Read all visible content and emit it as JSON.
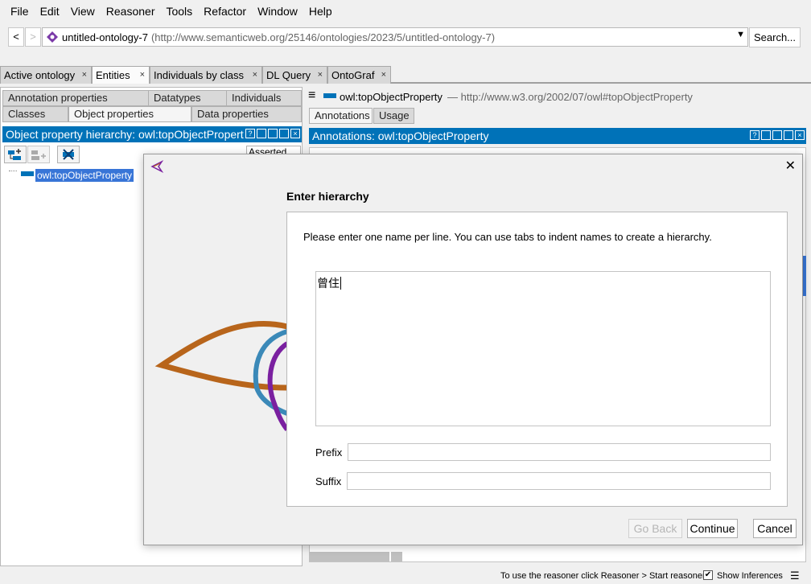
{
  "menu": [
    "File",
    "Edit",
    "View",
    "Reasoner",
    "Tools",
    "Refactor",
    "Window",
    "Help"
  ],
  "address": {
    "back": "<",
    "forward": ">",
    "ontology_name": "untitled-ontology-7",
    "ontology_iri": "(http://www.semanticweb.org/25146/ontologies/2023/5/untitled-ontology-7)",
    "search_label": "Search..."
  },
  "tabs": [
    {
      "label": "Active ontology"
    },
    {
      "label": "Entities",
      "active": true
    },
    {
      "label": "Individuals by class"
    },
    {
      "label": "DL Query"
    },
    {
      "label": "OntoGraf"
    }
  ],
  "close_glyph": "×",
  "left_panel": {
    "subtabs_row1": [
      "Annotation properties",
      "Datatypes",
      "Individuals"
    ],
    "subtabs_row2": [
      "Classes",
      "Object properties",
      "Data properties"
    ],
    "header": "Object property hierarchy: owl:topObjectProperty",
    "asserted": "Asserted",
    "tree_item": "owl:topObjectProperty"
  },
  "right_panel": {
    "entity_name": "owl:topObjectProperty",
    "entity_iri": "— http://www.w3.org/2002/07/owl#topObjectProperty",
    "tabs": [
      "Annotations",
      "Usage"
    ],
    "header": "Annotations: owl:topObjectProperty"
  },
  "status": {
    "message": "To use the reasoner click Reasoner > Start reasoner",
    "show_inferences": "Show Inferences",
    "show_inferences_checked": true
  },
  "dialog": {
    "title": "Enter hierarchy",
    "instructions": "Please enter one name per line. You can use tabs to indent names to create a hierarchy.",
    "text_value": "曾住",
    "prefix_label": "Prefix",
    "prefix_value": "",
    "suffix_label": "Suffix",
    "suffix_value": "",
    "go_back_label": "Go Back",
    "continue_label": "Continue",
    "cancel_label": "Cancel",
    "close_glyph": "✕"
  },
  "colors": {
    "accent_blue": "#0072b8",
    "selection": "#3875d7",
    "logo_orange": "#b8651b",
    "logo_blue": "#3b89b8",
    "logo_purple": "#7a20a0"
  }
}
